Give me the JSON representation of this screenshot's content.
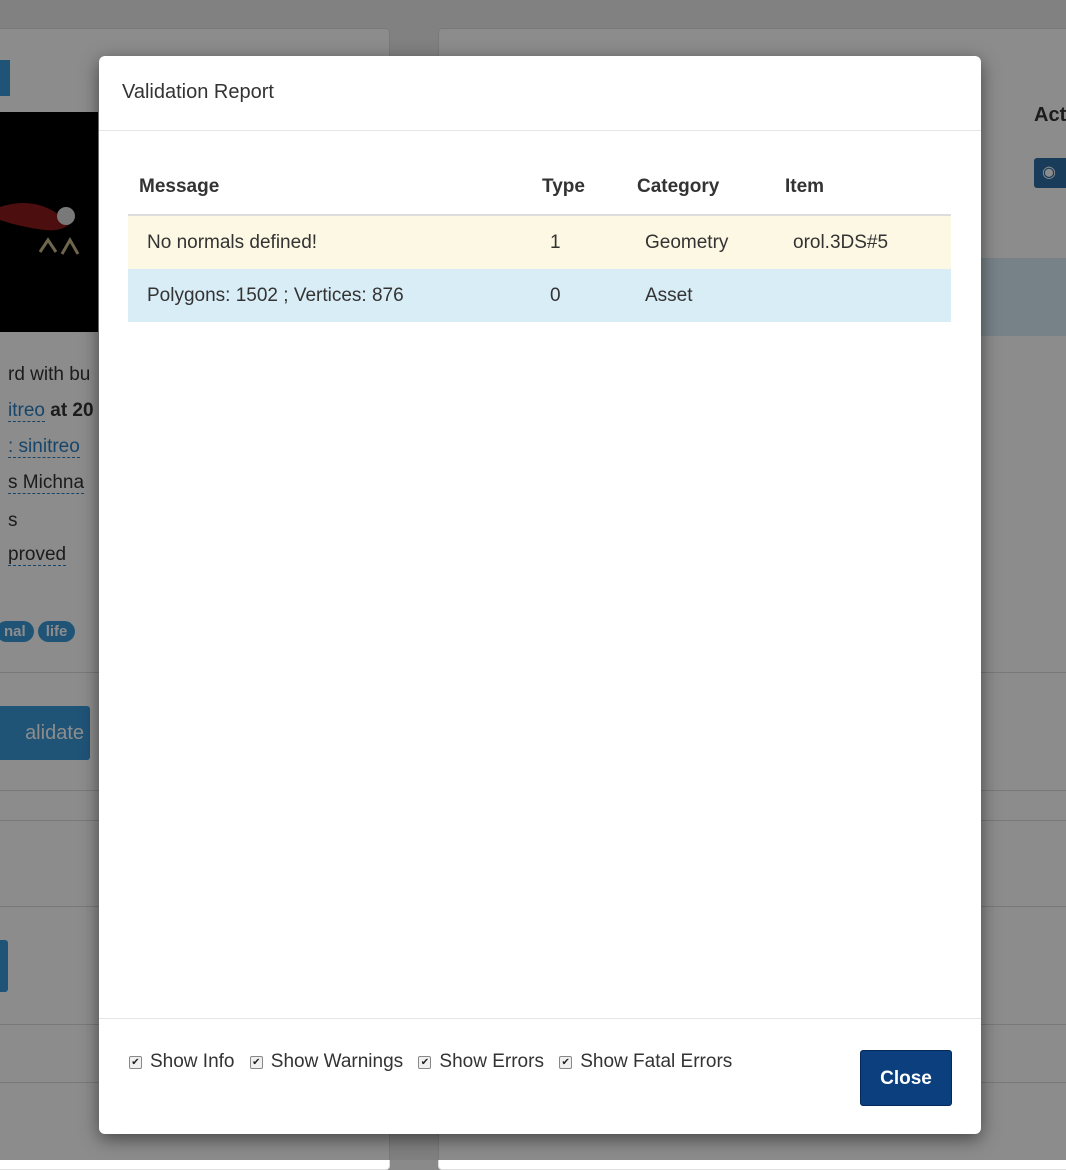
{
  "background": {
    "left_lines": [
      "rd with bu",
      "itreo at 20",
      ": sinitreo",
      "s Michna",
      "s",
      "proved"
    ],
    "left_link_fragments": [
      "itreo",
      "sinitreo"
    ],
    "tags": [
      "nal",
      "life"
    ],
    "validate_button": "alidate",
    "actions_header": "Act",
    "eye_icon": "eye-icon"
  },
  "modal": {
    "title": "Validation Report",
    "table": {
      "headers": [
        "Message",
        "Type",
        "Category",
        "Item"
      ],
      "rows": [
        {
          "message": "No normals defined!",
          "type": "1",
          "category": "Geometry",
          "item": "orol.3DS#5",
          "status": "warning"
        },
        {
          "message": "Polygons: 1502 ; Vertices: 876",
          "type": "0",
          "category": "Asset",
          "item": "",
          "status": "info"
        }
      ]
    },
    "filters": [
      {
        "label": "Show Info",
        "checked": true
      },
      {
        "label": "Show Warnings",
        "checked": true
      },
      {
        "label": "Show Errors",
        "checked": true
      },
      {
        "label": "Show Fatal Errors",
        "checked": true
      }
    ],
    "close_label": "Close"
  },
  "colors": {
    "warning_row": "#fcf8e3",
    "info_row": "#d9edf7",
    "primary_button": "#0b3f7e",
    "link": "#2a7fc1"
  }
}
